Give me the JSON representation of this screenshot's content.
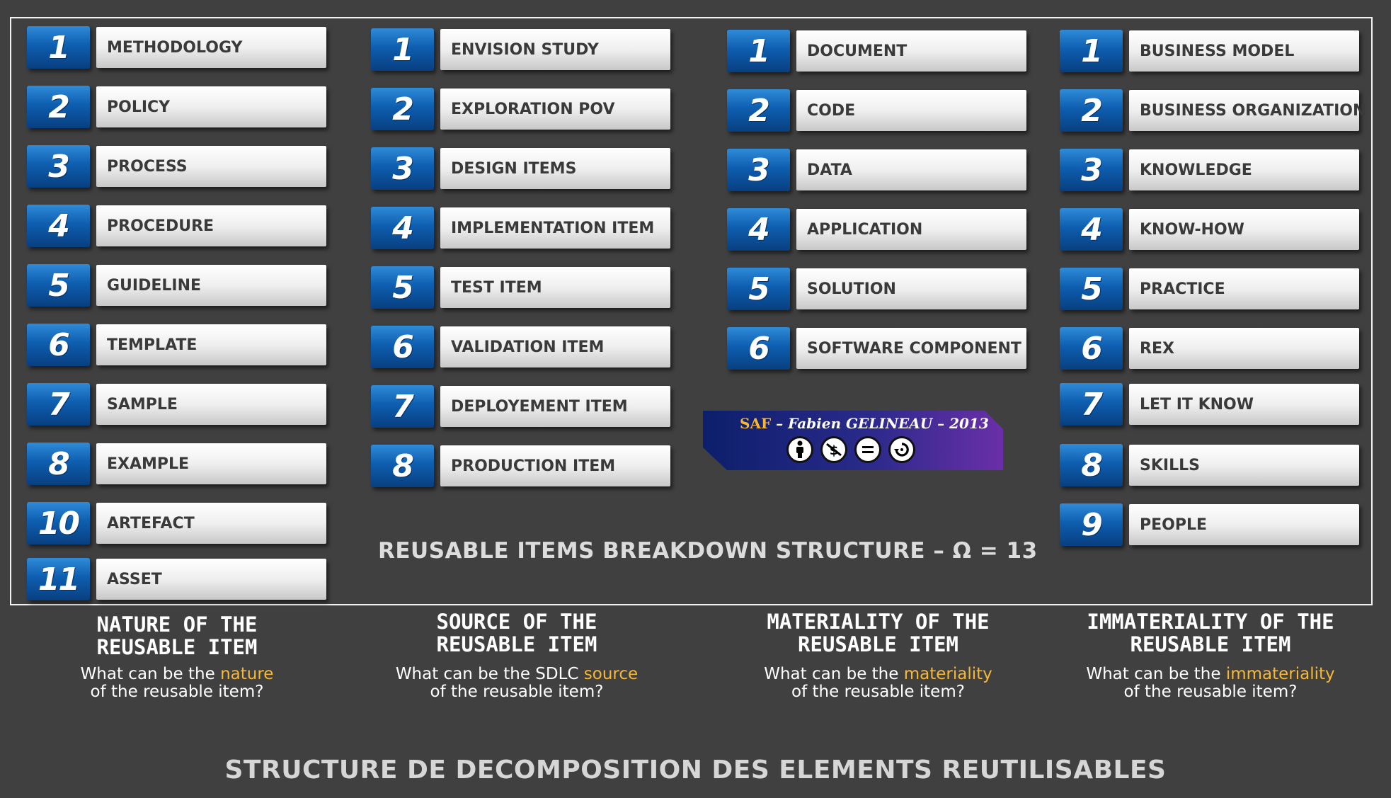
{
  "columns": [
    {
      "items": [
        {
          "num": "1",
          "label": "METHODOLOGY"
        },
        {
          "num": "2",
          "label": "POLICY"
        },
        {
          "num": "3",
          "label": "PROCESS"
        },
        {
          "num": "4",
          "label": "PROCEDURE"
        },
        {
          "num": "5",
          "label": "GUIDELINE"
        },
        {
          "num": "6",
          "label": "TEMPLATE"
        },
        {
          "num": "7",
          "label": "SAMPLE"
        },
        {
          "num": "8",
          "label": "EXAMPLE"
        },
        {
          "num": "10",
          "label": "ARTEFACT"
        },
        {
          "num": "11",
          "label": "ASSET"
        }
      ],
      "heading_line1": "NATURE OF THE",
      "heading_line2": "REUSABLE ITEM",
      "question_pre": "What can be the ",
      "question_hl": "nature",
      "question_post": "of the reusable item?"
    },
    {
      "items": [
        {
          "num": "1",
          "label": "ENVISION STUDY"
        },
        {
          "num": "2",
          "label": "EXPLORATION POV"
        },
        {
          "num": "3",
          "label": "DESIGN ITEMS"
        },
        {
          "num": "4",
          "label": "IMPLEMENTATION ITEM"
        },
        {
          "num": "5",
          "label": "TEST ITEM"
        },
        {
          "num": "6",
          "label": "VALIDATION ITEM"
        },
        {
          "num": "7",
          "label": "DEPLOYEMENT ITEM"
        },
        {
          "num": "8",
          "label": "PRODUCTION ITEM"
        }
      ],
      "heading_line1": "SOURCE OF THE",
      "heading_line2": "REUSABLE ITEM",
      "question_pre": "What can be the SDLC ",
      "question_hl": "source",
      "question_post": "of the reusable item?"
    },
    {
      "items": [
        {
          "num": "1",
          "label": "DOCUMENT"
        },
        {
          "num": "2",
          "label": "CODE"
        },
        {
          "num": "3",
          "label": "DATA"
        },
        {
          "num": "4",
          "label": "APPLICATION"
        },
        {
          "num": "5",
          "label": "SOLUTION"
        },
        {
          "num": "6",
          "label": "SOFTWARE COMPONENT"
        }
      ],
      "heading_line1": "MATERIALITY OF THE",
      "heading_line2": "REUSABLE ITEM",
      "question_pre": "What can be the ",
      "question_hl": "materiality",
      "question_post": "of the reusable item?"
    },
    {
      "items": [
        {
          "num": "1",
          "label": "BUSINESS MODEL"
        },
        {
          "num": "2",
          "label": "BUSINESS ORGANIZATION"
        },
        {
          "num": "3",
          "label": "KNOWLEDGE"
        },
        {
          "num": "4",
          "label": "KNOW-HOW"
        },
        {
          "num": "5",
          "label": "PRACTICE"
        },
        {
          "num": "6",
          "label": "REX"
        },
        {
          "num": "7",
          "label": "LET IT KNOW"
        },
        {
          "num": "8",
          "label": "SKILLS"
        },
        {
          "num": "9",
          "label": "PEOPLE"
        }
      ],
      "heading_line1": "IMMATERIALITY OF THE",
      "heading_line2": "REUSABLE ITEM",
      "question_pre": "What can be the ",
      "question_hl": "immateriality",
      "question_post": "of the reusable item?"
    }
  ],
  "inner_title": "REUSABLE ITEMS BREAKDOWN STRUCTURE – Ω = 13",
  "saf_badge": {
    "text_accent": "SAF",
    "text_rest": " – Fabien GELINEAU – 2013",
    "icons": [
      "attribution-icon",
      "noncommercial-icon",
      "noderivatives-icon",
      "sharealike-icon"
    ],
    "colors": {
      "left": "#0c1f6b",
      "right": "#6a2fa8",
      "accent": "#f7b733"
    }
  },
  "bottom_title": "STRUCTURE DE DECOMPOSITION DES ELEMENTS REUTILISABLES",
  "colors": {
    "background": "#404040",
    "badge_blue": "#0e5eb0",
    "highlight": "#f7b733"
  }
}
